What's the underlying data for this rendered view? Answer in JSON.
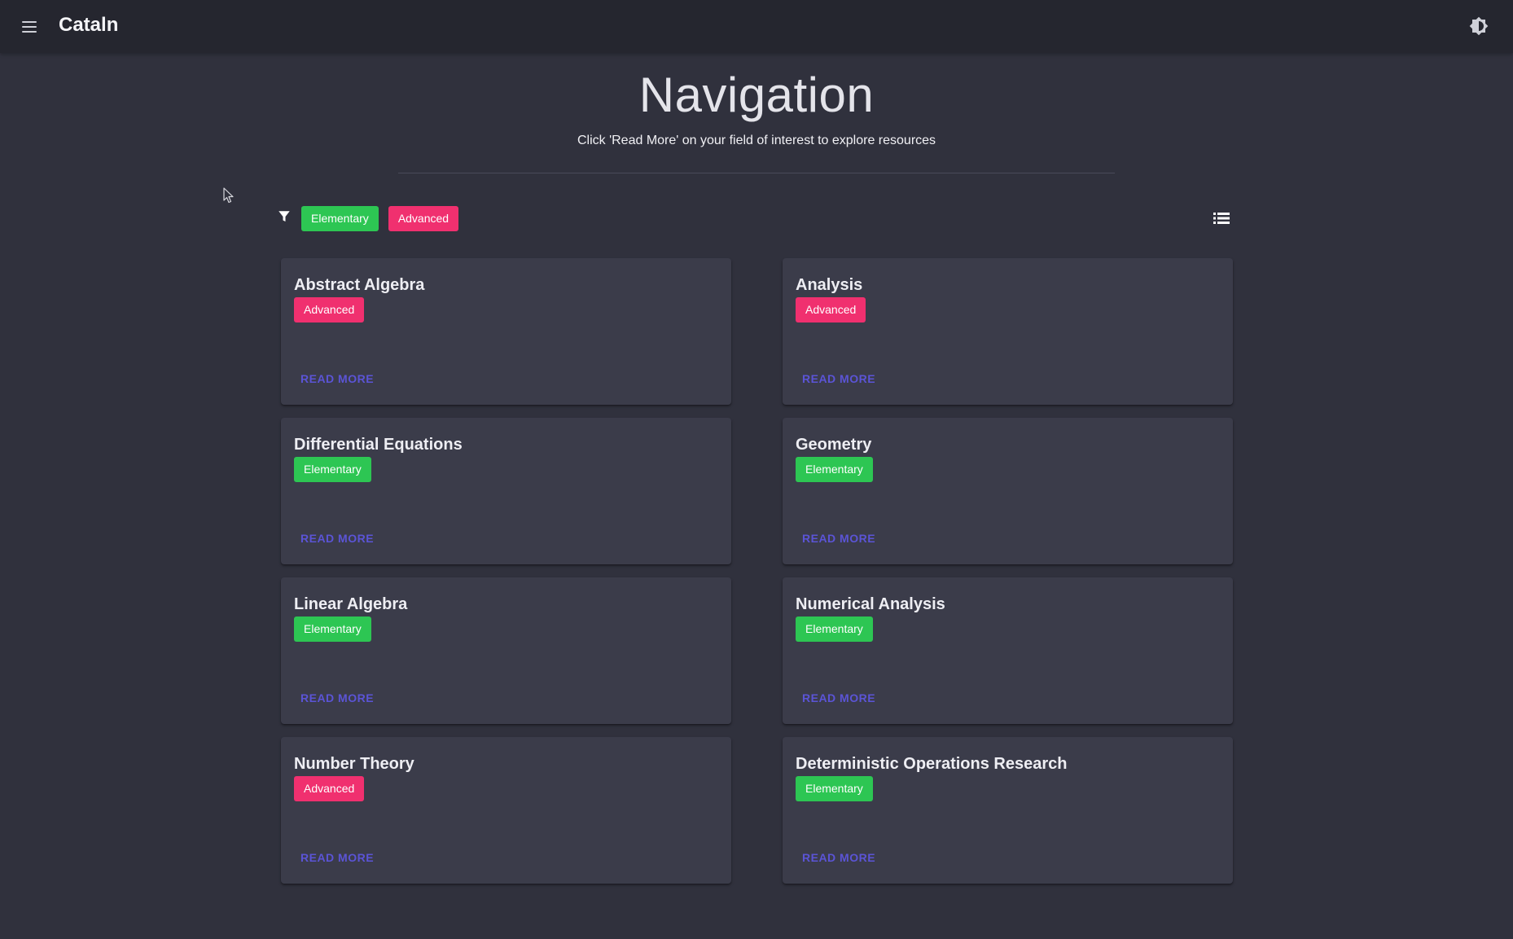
{
  "appbar": {
    "title": "Cataln"
  },
  "header": {
    "title": "Navigation",
    "subtitle": "Click 'Read More' on your field of interest to explore resources"
  },
  "filters": {
    "chips": [
      {
        "label": "Elementary",
        "color": "#2dc653"
      },
      {
        "label": "Advanced",
        "color": "#f0306f"
      }
    ]
  },
  "colors": {
    "background": "#30313d",
    "appbar": "#25262f",
    "card": "#3b3c4a",
    "elementary": "#2dc653",
    "advanced": "#f0306f",
    "link": "#5b54d6"
  },
  "cards": [
    {
      "title": "Abstract Algebra",
      "level": "Advanced",
      "action": "READ MORE"
    },
    {
      "title": "Analysis",
      "level": "Advanced",
      "action": "READ MORE"
    },
    {
      "title": "Differential Equations",
      "level": "Elementary",
      "action": "READ MORE"
    },
    {
      "title": "Geometry",
      "level": "Elementary",
      "action": "READ MORE"
    },
    {
      "title": "Linear Algebra",
      "level": "Elementary",
      "action": "READ MORE"
    },
    {
      "title": "Numerical Analysis",
      "level": "Elementary",
      "action": "READ MORE"
    },
    {
      "title": "Number Theory",
      "level": "Advanced",
      "action": "READ MORE"
    },
    {
      "title": "Deterministic Operations Research",
      "level": "Elementary",
      "action": "READ MORE"
    }
  ]
}
